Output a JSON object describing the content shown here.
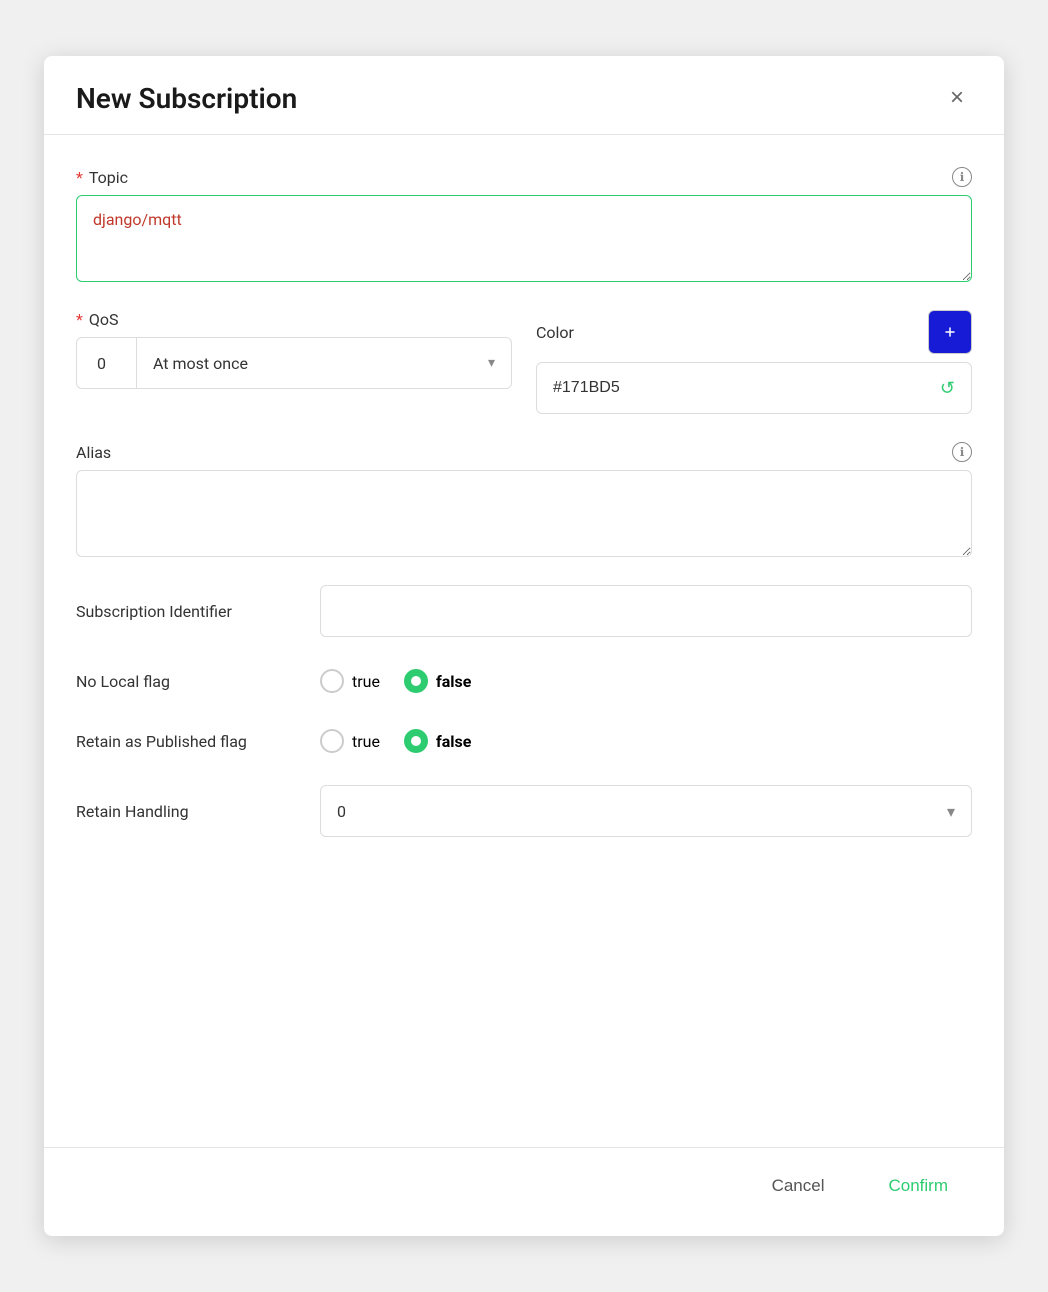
{
  "dialog": {
    "title": "New Subscription",
    "close_label": "×"
  },
  "topic": {
    "label": "Topic",
    "required": "*",
    "value": "django/mqtt",
    "info_label": "ℹ"
  },
  "qos": {
    "label": "QoS",
    "required": "*",
    "number": "0",
    "option_label": "At most once",
    "arrow": "▾"
  },
  "color": {
    "label": "Color",
    "value": "#171BD5",
    "refresh_icon": "↺"
  },
  "alias": {
    "label": "Alias",
    "info_label": "ℹ",
    "value": ""
  },
  "subscription_identifier": {
    "label": "Subscription Identifier",
    "value": "",
    "placeholder": ""
  },
  "no_local_flag": {
    "label": "No Local flag",
    "true_label": "true",
    "false_label": "false",
    "selected": "false"
  },
  "retain_as_published_flag": {
    "label": "Retain as Published flag",
    "true_label": "true",
    "false_label": "false",
    "selected": "false"
  },
  "retain_handling": {
    "label": "Retain Handling",
    "value": "0",
    "arrow": "▾"
  },
  "footer": {
    "cancel_label": "Cancel",
    "confirm_label": "Confirm"
  }
}
